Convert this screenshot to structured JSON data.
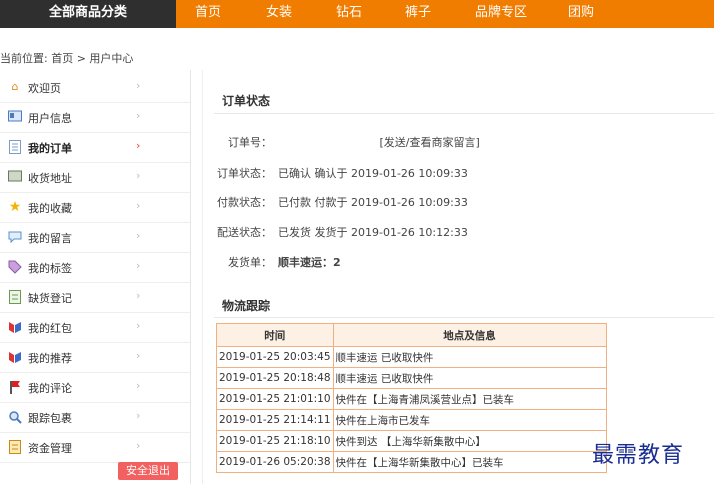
{
  "topnav": {
    "category_label": "全部商品分类",
    "items": [
      "首页",
      "女装",
      "钻石",
      "裤子",
      "品牌专区",
      "团购"
    ]
  },
  "breadcrumb": "当前位置: 首页 > 用户中心",
  "sidebar": {
    "items": [
      {
        "label": "欢迎页",
        "icon": "home-icon"
      },
      {
        "label": "用户信息",
        "icon": "id-card-icon"
      },
      {
        "label": "我的订单",
        "icon": "document-icon"
      },
      {
        "label": "收货地址",
        "icon": "address-icon"
      },
      {
        "label": "我的收藏",
        "icon": "star-icon"
      },
      {
        "label": "我的留言",
        "icon": "message-icon"
      },
      {
        "label": "我的标签",
        "icon": "tag-icon"
      },
      {
        "label": "缺货登记",
        "icon": "register-icon"
      },
      {
        "label": "我的红包",
        "icon": "red-packet-icon"
      },
      {
        "label": "我的推荐",
        "icon": "recommend-icon"
      },
      {
        "label": "我的评论",
        "icon": "flag-icon"
      },
      {
        "label": "跟踪包裹",
        "icon": "track-icon"
      },
      {
        "label": "资金管理",
        "icon": "money-icon"
      }
    ],
    "logout_label": "安全退出"
  },
  "order_status": {
    "title": "订单状态",
    "order_no_label": "订单号：",
    "order_no_suffix": "[发送/查看商家留言]",
    "status_label": "订单状态：",
    "status_value": "已确认  确认于 2019-01-26 10:09:33",
    "pay_label": "付款状态：",
    "pay_value": "已付款  付款于 2019-01-26 10:09:33",
    "ship_label": "配送状态：",
    "ship_value": "已发货  发货于 2019-01-26 10:12:33",
    "invoice_label": "发货单：",
    "invoice_value": "顺丰速运：2"
  },
  "logistics": {
    "title": "物流跟踪",
    "headers": [
      "时间",
      "地点及信息"
    ],
    "rows": [
      {
        "time": "2019-01-25 20:03:45",
        "info": "顺丰速运 已收取快件"
      },
      {
        "time": "2019-01-25 20:18:48",
        "info": "顺丰速运 已收取快件"
      },
      {
        "time": "2019-01-25 21:01:10",
        "info": "快件在【上海青浦凤溪营业点】已装车"
      },
      {
        "time": "2019-01-25 21:14:11",
        "info": "快件在上海市已发车"
      },
      {
        "time": "2019-01-25 21:18:10",
        "info": "快件到达 【上海华新集散中心】"
      },
      {
        "time": "2019-01-26 05:20:38",
        "info": "快件在【上海华新集散中心】已装车"
      }
    ]
  },
  "watermark": "最需教育",
  "colors": {
    "nav_orange": "#f07c00",
    "nav_dark": "#2f2f2f",
    "logout_red": "#f26060",
    "table_border": "#f0b080",
    "watermark_blue": "#1a2d90"
  }
}
